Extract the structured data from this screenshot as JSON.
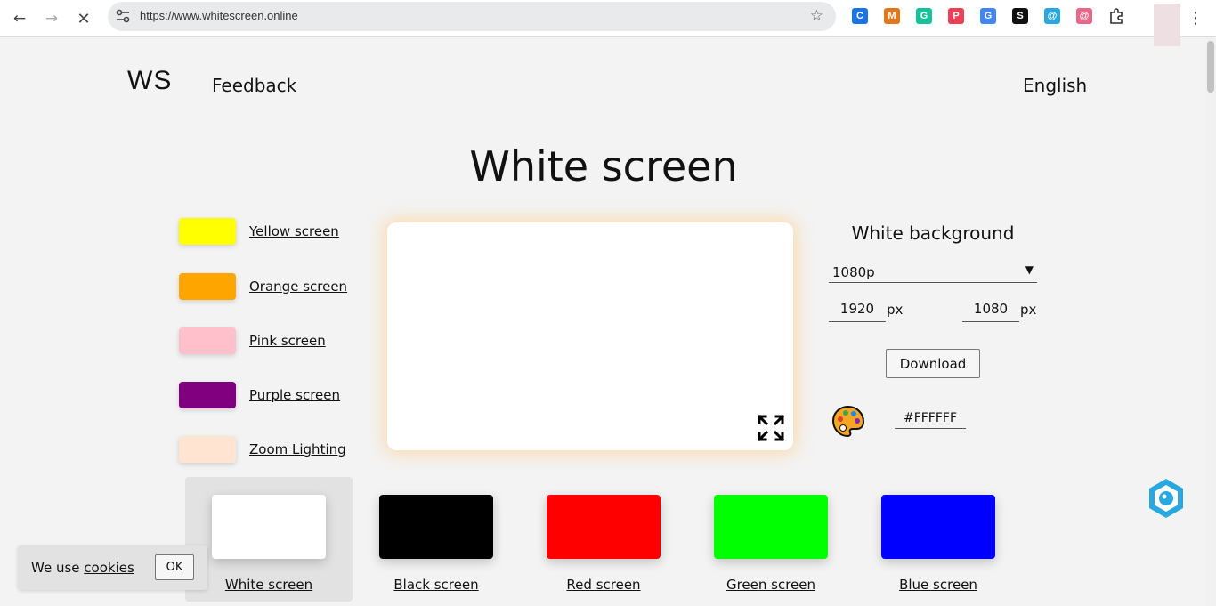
{
  "browser": {
    "url": "https://www.whitescreen.online",
    "extensions": [
      {
        "name": "copyright-icon",
        "glyph": "C",
        "color": "#1a73e8"
      },
      {
        "name": "metamask-icon",
        "glyph": "M",
        "color": "#e2761b"
      },
      {
        "name": "grammarly-icon",
        "glyph": "G",
        "color": "#15c39a"
      },
      {
        "name": "pocket-icon",
        "glyph": "P",
        "color": "#ef3f56"
      },
      {
        "name": "translate-icon",
        "glyph": "G",
        "color": "#4285f4"
      },
      {
        "name": "s-extension-icon",
        "glyph": "S",
        "color": "#111111"
      },
      {
        "name": "sync-icon",
        "glyph": "@",
        "color": "#29a8e0"
      },
      {
        "name": "camera-icon",
        "glyph": "@",
        "color": "#e8678a"
      }
    ]
  },
  "header": {
    "logo": "WS",
    "feedback": "Feedback",
    "language": "English"
  },
  "page": {
    "title": "White screen"
  },
  "colors": [
    {
      "label": "Yellow screen",
      "color": "#ffff00"
    },
    {
      "label": "Orange screen",
      "color": "#ffa500"
    },
    {
      "label": "Pink screen",
      "color": "#ffc0cb"
    },
    {
      "label": "Purple screen",
      "color": "#800080"
    },
    {
      "label": "Zoom Lighting",
      "color": "#ffe4d1"
    }
  ],
  "panel": {
    "title": "White background",
    "resolution": "1080p",
    "width": "1920",
    "height": "1080",
    "unit": "px",
    "download": "Download",
    "hex": "#FFFFFF"
  },
  "tiles": [
    {
      "label": "White screen",
      "color": "#ffffff"
    },
    {
      "label": "Black screen",
      "color": "#000000"
    },
    {
      "label": "Red screen",
      "color": "#ff0000"
    },
    {
      "label": "Green screen",
      "color": "#00ff00"
    },
    {
      "label": "Blue screen",
      "color": "#0000ff"
    }
  ],
  "cookie": {
    "prefix": "We use",
    "link": "cookies",
    "ok": "OK"
  }
}
